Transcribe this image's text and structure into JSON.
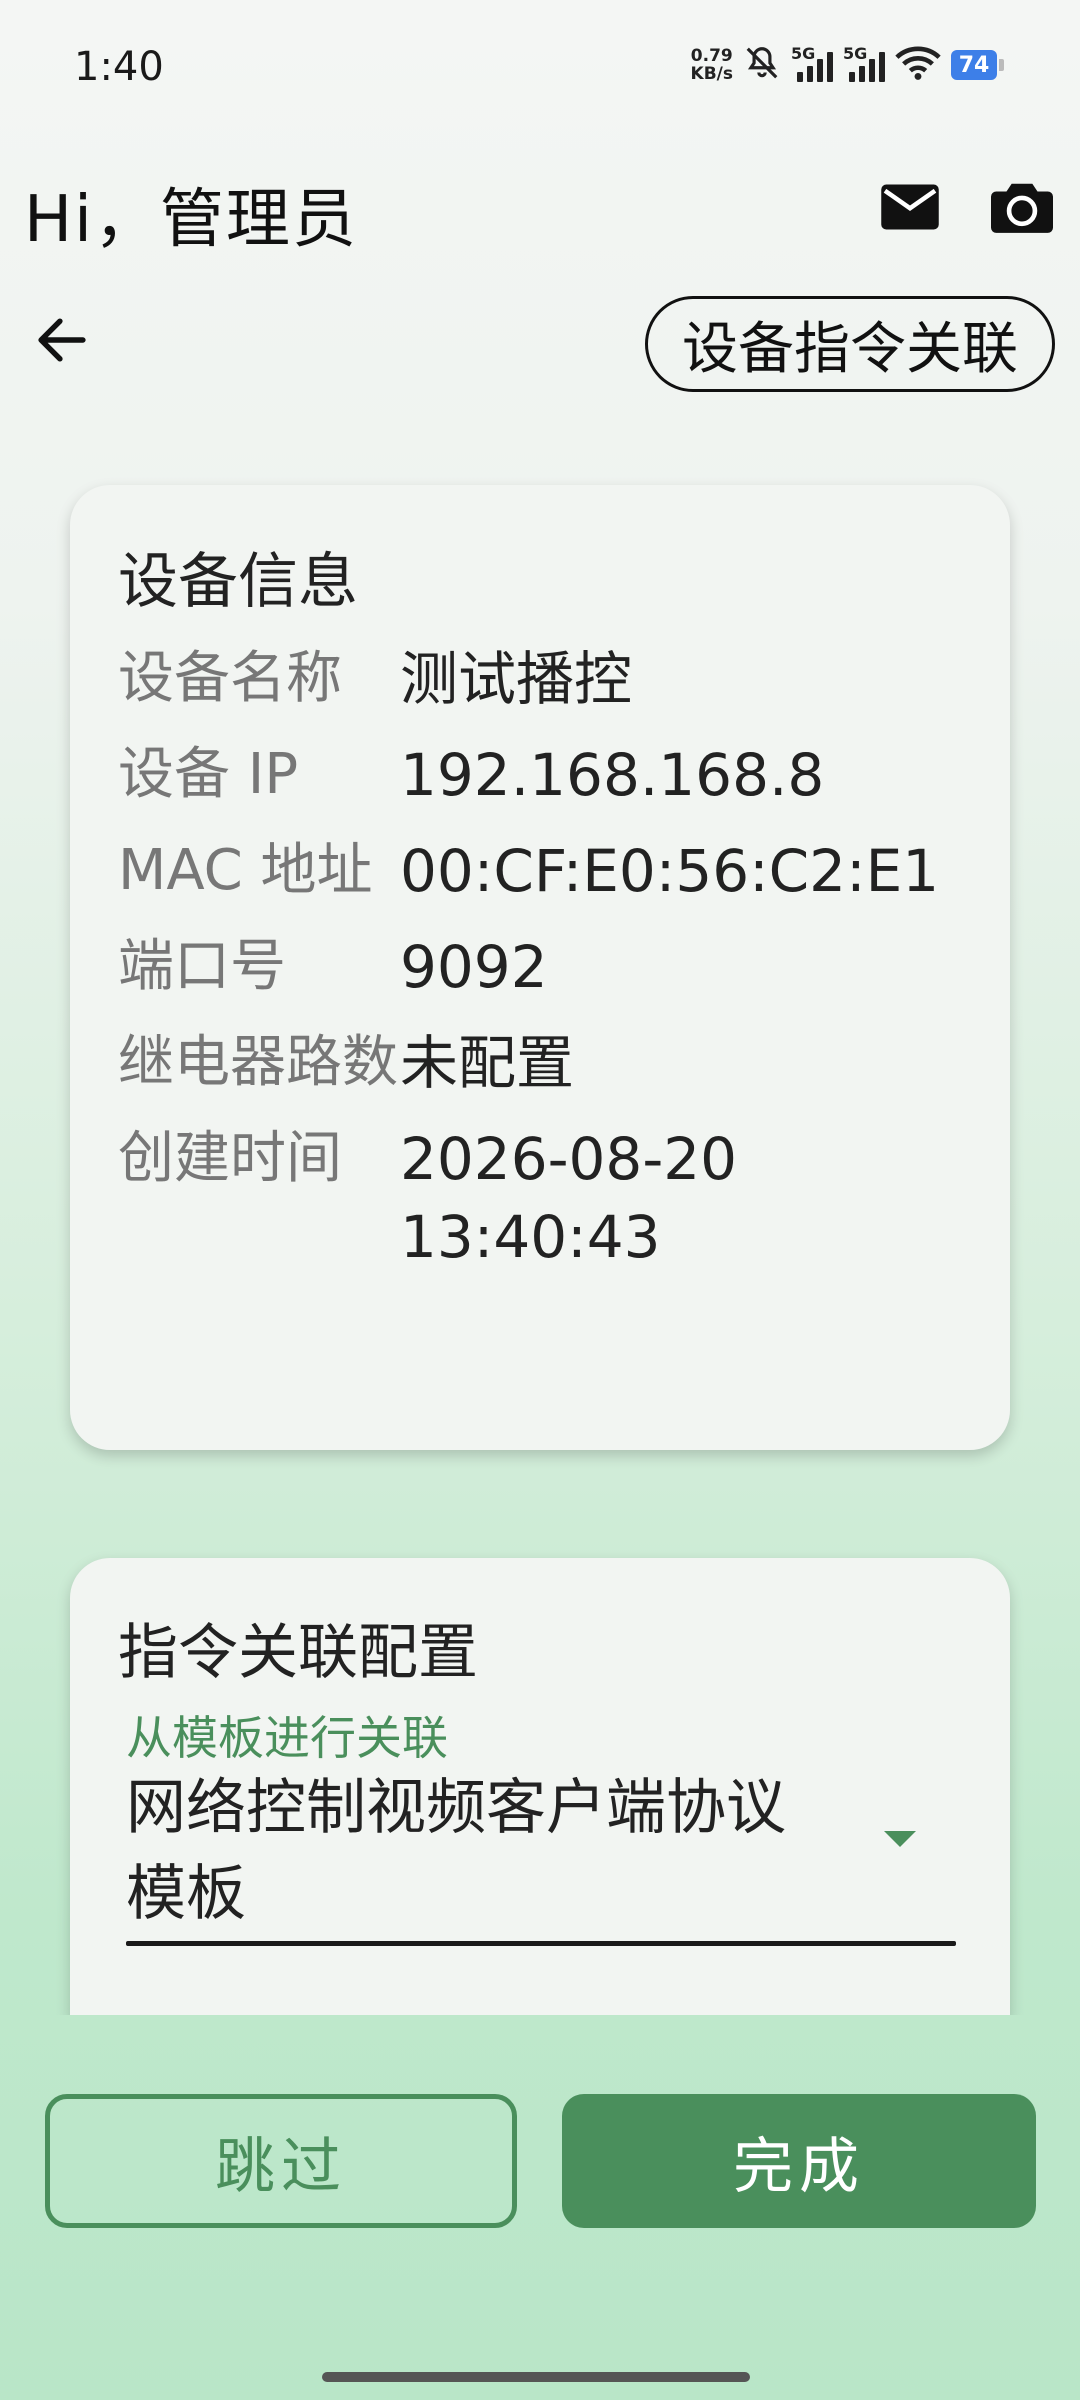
{
  "status_bar": {
    "time": "1:40",
    "net_speed_value": "0.79",
    "net_speed_unit": "KB/s",
    "sim1_label": "5G",
    "sim2_label": "5G",
    "battery": "74"
  },
  "header": {
    "greeting": "Hi，管理员",
    "mail_icon": "mail-icon",
    "camera_icon": "camera-icon"
  },
  "nav": {
    "back_icon": "arrow-left-icon",
    "title": "设备指令关联"
  },
  "device_info": {
    "title": "设备信息",
    "rows": [
      {
        "label": "设备名称",
        "value": "测试播控"
      },
      {
        "label": "设备 IP",
        "value": "192.168.168.8"
      },
      {
        "label": "MAC 地址",
        "value": "00:CF:E0:56:C2:E1"
      },
      {
        "label": "端口号",
        "value": "9092"
      },
      {
        "label": "继电器路数",
        "value": "未配置"
      },
      {
        "label": "创建时间",
        "value": "2026-08-20 13:40:43"
      }
    ]
  },
  "config": {
    "title": "指令关联配置",
    "select_label": "从模板进行关联",
    "select_value": "网络控制视频客户端协议模板"
  },
  "actions": {
    "skip_label": "跳过",
    "done_label": "完成"
  },
  "colors": {
    "accent": "#4a8f5c"
  }
}
